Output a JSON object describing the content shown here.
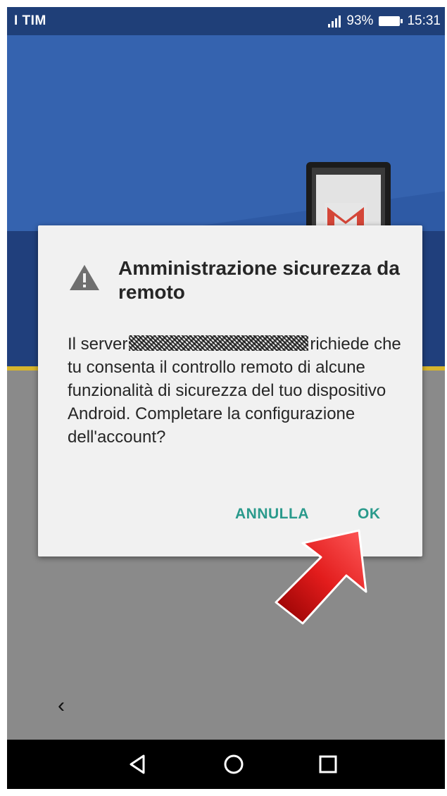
{
  "status_bar": {
    "carrier": "I TIM",
    "battery_percent": "93%",
    "time": "15:31"
  },
  "dialog": {
    "title": "Amministrazione sicurezza da remoto",
    "body_prefix": "Il server",
    "body_suffix": "richiede che tu consenta il controllo remoto di alcune funzionalità di sicurezza del tuo dispositivo Android. Completare la configurazione dell'account?",
    "cancel_label": "ANNULLA",
    "ok_label": "OK"
  },
  "background": {
    "back_label": "‹"
  },
  "icons": [
    "warning-icon",
    "gmail-icon",
    "back-chevron-icon",
    "nav-back-icon",
    "nav-home-icon",
    "nav-recents-icon",
    "signal-icon",
    "battery-icon"
  ],
  "colors": {
    "accent": "#2a9a8c",
    "hero_blue": "#2e5aa5",
    "dialog_bg": "#f1f1f1",
    "annotation_arrow": "#d21414"
  }
}
